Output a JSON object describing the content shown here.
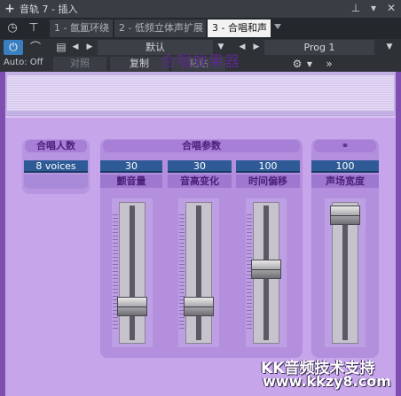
{
  "titlebar": {
    "title": "音轨 7 - 插入"
  },
  "tabs": [
    {
      "label": "1 - 氤氲环绕",
      "active": false
    },
    {
      "label": "2 - 低频立体声扩展",
      "active": false
    },
    {
      "label": "3 - 合唱和声",
      "active": true
    }
  ],
  "toolbar": {
    "preset": "默认",
    "program": "Prog 1",
    "auto_label": "Auto: Off",
    "compare_label": "对照",
    "copy_label": "复制",
    "paste_label": "粘贴"
  },
  "plugin": {
    "title": "合唱效果器",
    "voices_group": {
      "header": "合唱人数",
      "value": "8 voices"
    },
    "params_group": {
      "header": "合唱参数",
      "params": [
        {
          "label": "颤音量",
          "value": "30",
          "level": 0.21
        },
        {
          "label": "音高变化",
          "value": "30",
          "level": 0.21
        },
        {
          "label": "时间偏移",
          "value": "100",
          "level": 0.53
        }
      ]
    },
    "stereo_group": {
      "header_icon": "stereo-link-icon",
      "param": {
        "label": "声场宽度",
        "value": "100",
        "level": 1.0
      }
    }
  },
  "watermark": {
    "line1": "KK音频技术支持",
    "line2": "www.kkzy8.com"
  },
  "colors": {
    "accent_blue": "#3a7fc0",
    "panel_purple": "#c6a5ea",
    "value_box": "#2e5b96",
    "title_purple": "#5a2a8a"
  }
}
